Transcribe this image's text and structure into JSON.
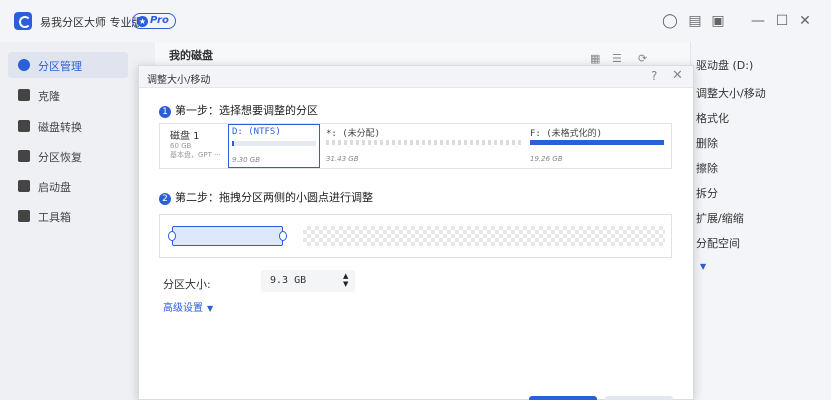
{
  "app": {
    "title": "易我分区大师 专业版",
    "badge": "Pro"
  },
  "window_controls": {
    "tips_icon": "lightbulb-icon",
    "feedback_icon": "feedback-icon",
    "menu_icon": "menu-icon",
    "minimize": "—",
    "maximize": "☐",
    "close": "✕"
  },
  "sidebar": {
    "items": [
      {
        "label": "分区管理",
        "icon": "partition-icon",
        "active": true
      },
      {
        "label": "克隆",
        "icon": "clone-icon"
      },
      {
        "label": "磁盘转换",
        "icon": "disk-convert-icon"
      },
      {
        "label": "分区恢复",
        "icon": "recovery-icon"
      },
      {
        "label": "启动盘",
        "icon": "bootable-icon"
      },
      {
        "label": "工具箱",
        "icon": "toolbox-icon"
      }
    ]
  },
  "main": {
    "title": "我的磁盘"
  },
  "ops": {
    "items": [
      {
        "label": "驱动盘 (D:)"
      },
      {
        "label": "调整大小/移动"
      },
      {
        "label": "格式化"
      },
      {
        "label": "删除"
      },
      {
        "label": "擦除"
      },
      {
        "label": "拆分"
      },
      {
        "label": "扩展/缩缩"
      },
      {
        "label": "分配空间"
      }
    ]
  },
  "dialog": {
    "title": "调整大小/移动",
    "help": "?",
    "close": "✕",
    "step1": {
      "num": "1",
      "label": "第一步：选择想要调整的分区"
    },
    "disk": {
      "name": "磁盘 1",
      "size": "60 GB",
      "type": "基本盘，GPT ···"
    },
    "partitions": [
      {
        "label": "D: (NTFS)",
        "size": "9.30 GB",
        "used_fraction": 0.02,
        "selected": true
      },
      {
        "label": "*: (未分配)",
        "size": "31.43 GB",
        "unallocated": true
      },
      {
        "label": "F: (未格式化的)",
        "size": "19.26 GB",
        "used_fraction": 1.0
      }
    ],
    "step2": {
      "num": "2",
      "label": "第二步：拖拽分区两侧的小圆点进行调整"
    },
    "size_label": "分区大小:",
    "size_value": "9.3 GB",
    "advanced": "高级设置"
  }
}
